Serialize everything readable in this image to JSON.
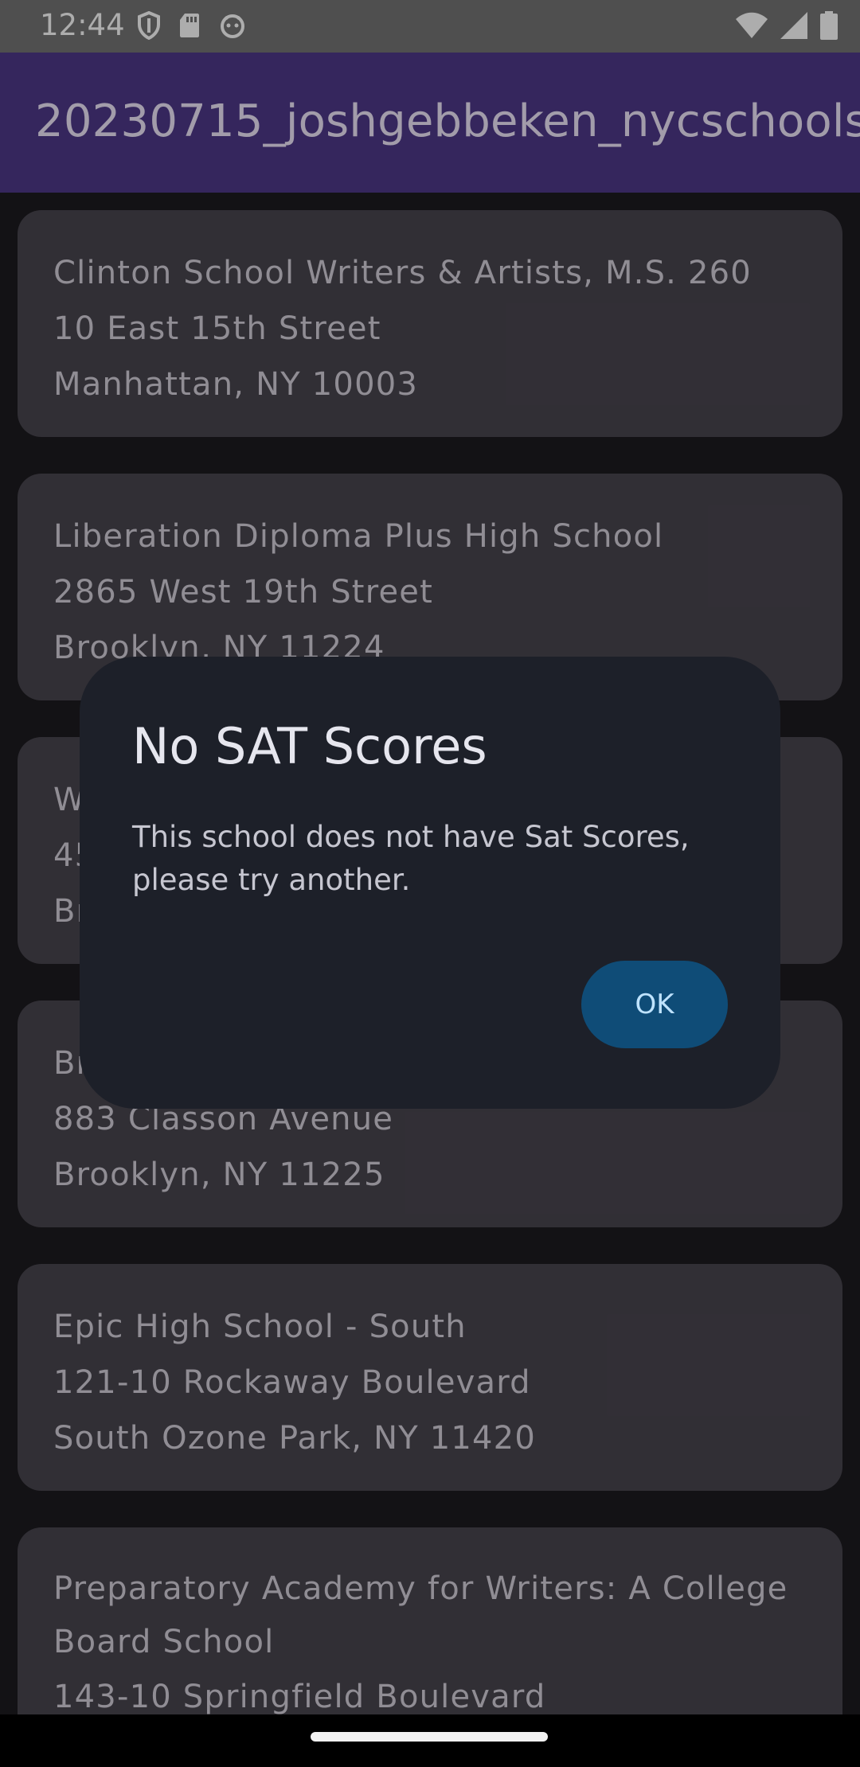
{
  "status_bar": {
    "time": "12:44",
    "left_icons": [
      "shield-icon",
      "sd-card-icon",
      "android-debug-icon"
    ],
    "right_icons": [
      "wifi-icon",
      "signal-icon",
      "battery-icon"
    ]
  },
  "app_bar": {
    "title": "20230715_joshgebbeken_nycschools"
  },
  "schools": [
    {
      "name": "Clinton School Writers & Artists, M.S. 260",
      "street": "10 East 15th Street",
      "city": "Manhattan, NY 10003"
    },
    {
      "name": "Liberation Diploma Plus High School",
      "street": "2865 West 19th Street",
      "city": "Brooklyn, NY 11224"
    },
    {
      "name": "W",
      "street": "45",
      "city": "Br"
    },
    {
      "name": "Br",
      "street": "883 Classon Avenue",
      "city": "Brooklyn, NY 11225"
    },
    {
      "name": "Epic High School - South",
      "street": "121-10 Rockaway Boulevard",
      "city": "South Ozone Park, NY 11420"
    },
    {
      "name": "Preparatory Academy for Writers: A College Board School",
      "street": "143-10 Springfield Boulevard",
      "city": ""
    }
  ],
  "dialog": {
    "title": "No SAT Scores",
    "message": "This school does not have Sat Scores, please try another.",
    "ok_label": "OK"
  },
  "colors": {
    "status_bar": "#757575",
    "app_bar": "#4e3989",
    "background": "#1d1b20",
    "card": "#49464f",
    "dialog": "#1d2029",
    "ok_button": "#0f4c77"
  }
}
